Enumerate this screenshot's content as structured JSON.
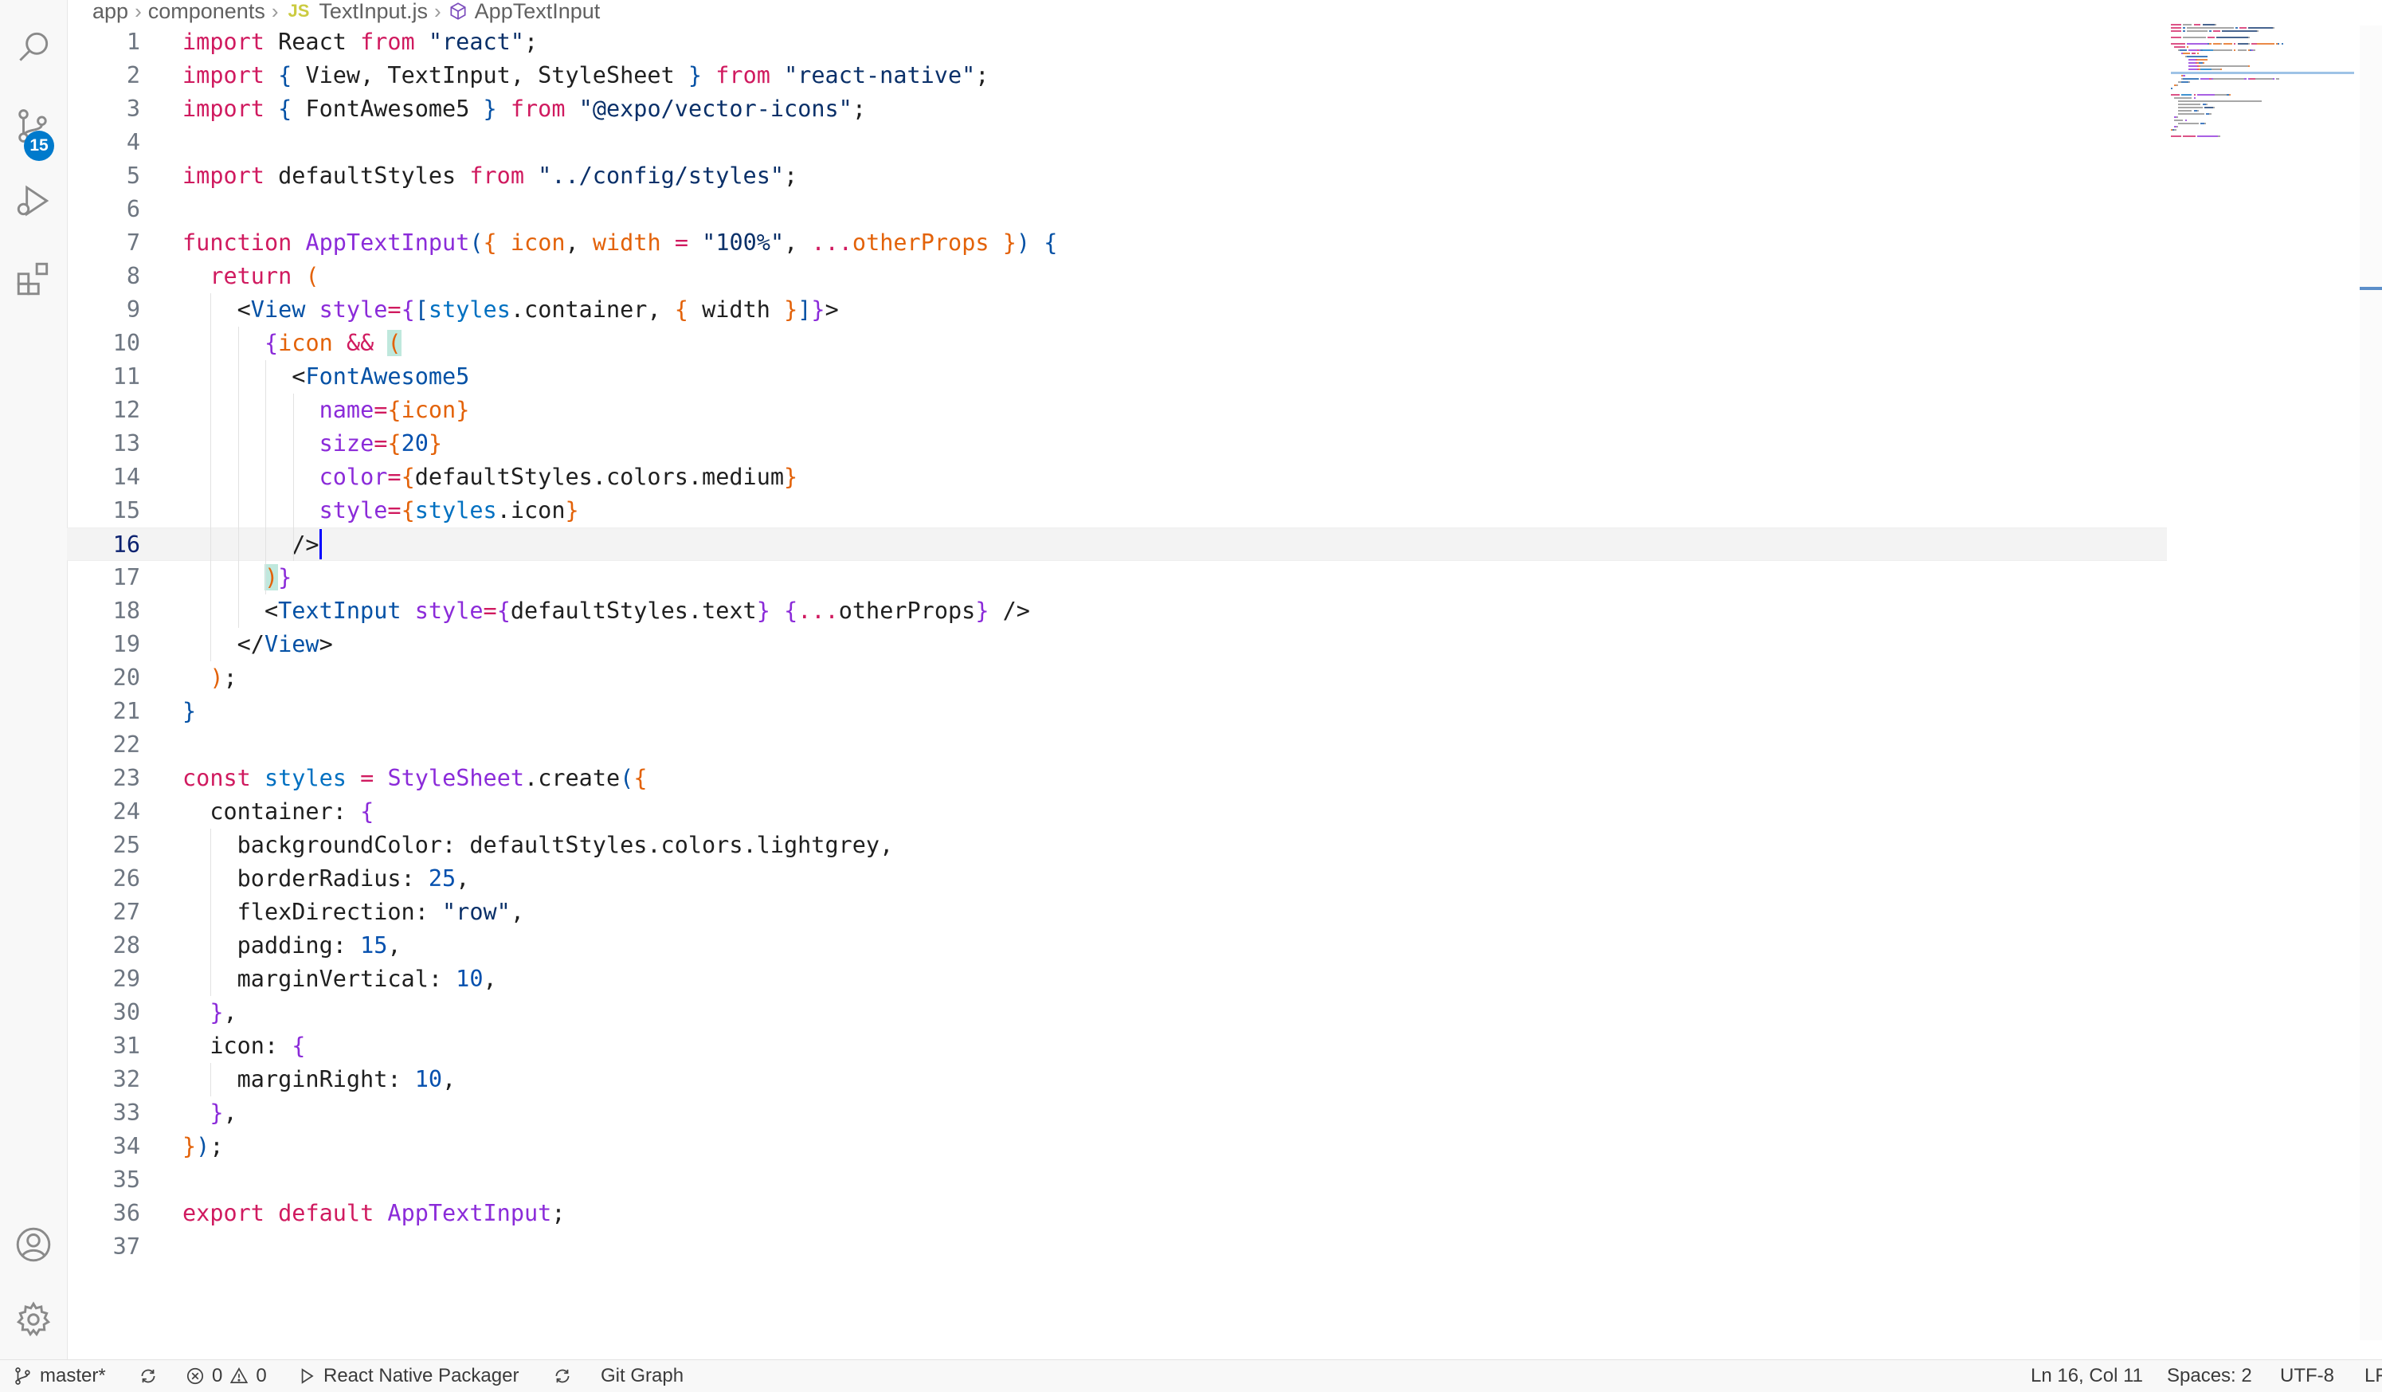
{
  "breadcrumb": {
    "items": [
      "app",
      "components",
      "TextInput.js",
      "AppTextInput"
    ],
    "file_badge": "JS"
  },
  "activity": {
    "scm_badge": "15"
  },
  "editor": {
    "active_line": 16,
    "lines": [
      {
        "n": "1",
        "t": [
          [
            "kw",
            "import"
          ],
          [
            "",
            " React "
          ],
          [
            "kw",
            "from"
          ],
          [
            "",
            ""
          ],
          [
            "str",
            " \"react\""
          ],
          [
            "",
            ";"
          ]
        ]
      },
      {
        "n": "2",
        "t": [
          [
            "kw",
            "import"
          ],
          [
            "",
            " "
          ],
          [
            "b1",
            "{"
          ],
          [
            "",
            " View, TextInput, StyleSheet "
          ],
          [
            "b1",
            "}"
          ],
          [
            "",
            " "
          ],
          [
            "kw",
            "from"
          ],
          [
            "",
            " "
          ],
          [
            "str",
            "\"react-native\""
          ],
          [
            "",
            ";"
          ]
        ]
      },
      {
        "n": "3",
        "t": [
          [
            "kw",
            "import"
          ],
          [
            "",
            " "
          ],
          [
            "b1",
            "{"
          ],
          [
            "",
            " FontAwesome5 "
          ],
          [
            "b1",
            "}"
          ],
          [
            "",
            " "
          ],
          [
            "kw",
            "from"
          ],
          [
            "",
            " "
          ],
          [
            "str",
            "\"@expo/vector-icons\""
          ],
          [
            "",
            ";"
          ]
        ]
      },
      {
        "n": "4",
        "t": []
      },
      {
        "n": "5",
        "t": [
          [
            "kw",
            "import"
          ],
          [
            "",
            " defaultStyles "
          ],
          [
            "kw",
            "from"
          ],
          [
            "",
            " "
          ],
          [
            "str",
            "\"../config/styles\""
          ],
          [
            "",
            ";"
          ]
        ]
      },
      {
        "n": "6",
        "t": []
      },
      {
        "n": "7",
        "t": [
          [
            "kw",
            "function"
          ],
          [
            "",
            " "
          ],
          [
            "fn",
            "AppTextInput"
          ],
          [
            "b1",
            "("
          ],
          [
            "b2",
            "{"
          ],
          [
            "",
            " "
          ],
          [
            "pm",
            "icon"
          ],
          [
            "",
            ", "
          ],
          [
            "pm",
            "width"
          ],
          [
            "",
            " "
          ],
          [
            "op",
            "="
          ],
          [
            "",
            " "
          ],
          [
            "str",
            "\"100%\""
          ],
          [
            "",
            ", "
          ],
          [
            "op",
            "..."
          ],
          [
            "pm",
            "otherProps"
          ],
          [
            "",
            " "
          ],
          [
            "b2",
            "}"
          ],
          [
            "b1",
            ")"
          ],
          [
            "",
            " "
          ],
          [
            "b1",
            "{"
          ]
        ]
      },
      {
        "n": "8",
        "t": [
          [
            "",
            "  "
          ],
          [
            "kw",
            "return"
          ],
          [
            "",
            " "
          ],
          [
            "b2",
            "("
          ]
        ]
      },
      {
        "n": "9",
        "t": [
          [
            "",
            "    <"
          ],
          [
            "tg",
            "View"
          ],
          [
            "",
            " "
          ],
          [
            "fn",
            "style"
          ],
          [
            "op",
            "="
          ],
          [
            "b3",
            "{"
          ],
          [
            "b1",
            "["
          ],
          [
            "vr",
            "styles"
          ],
          [
            "",
            ".container, "
          ],
          [
            "b2",
            "{"
          ],
          [
            "",
            " width "
          ],
          [
            "b2",
            "}"
          ],
          [
            "b1",
            "]"
          ],
          [
            "b3",
            "}"
          ],
          [
            "",
            ">"
          ]
        ]
      },
      {
        "n": "10",
        "t": [
          [
            "",
            "      "
          ],
          [
            "b3",
            "{"
          ],
          [
            "pm",
            "icon"
          ],
          [
            "",
            " "
          ],
          [
            "op",
            "&&"
          ],
          [
            "",
            " "
          ],
          [
            "hlb2",
            "("
          ]
        ]
      },
      {
        "n": "11",
        "t": [
          [
            "",
            "        <"
          ],
          [
            "tg",
            "FontAwesome5"
          ]
        ]
      },
      {
        "n": "12",
        "t": [
          [
            "",
            "          "
          ],
          [
            "fn",
            "name"
          ],
          [
            "op",
            "="
          ],
          [
            "b2",
            "{"
          ],
          [
            "pm",
            "icon"
          ],
          [
            "b2",
            "}"
          ]
        ]
      },
      {
        "n": "13",
        "t": [
          [
            "",
            "          "
          ],
          [
            "fn",
            "size"
          ],
          [
            "op",
            "="
          ],
          [
            "b2",
            "{"
          ],
          [
            "nm",
            "20"
          ],
          [
            "b2",
            "}"
          ]
        ]
      },
      {
        "n": "14",
        "t": [
          [
            "",
            "          "
          ],
          [
            "fn",
            "color"
          ],
          [
            "op",
            "="
          ],
          [
            "b2",
            "{"
          ],
          [
            "",
            "defaultStyles.colors.medium"
          ],
          [
            "b2",
            "}"
          ]
        ]
      },
      {
        "n": "15",
        "t": [
          [
            "",
            "          "
          ],
          [
            "fn",
            "style"
          ],
          [
            "op",
            "="
          ],
          [
            "b2",
            "{"
          ],
          [
            "vr",
            "styles"
          ],
          [
            "",
            ".icon"
          ],
          [
            "b2",
            "}"
          ]
        ]
      },
      {
        "n": "16",
        "t": [
          [
            "",
            "        />"
          ]
        ]
      },
      {
        "n": "17",
        "t": [
          [
            "",
            "      "
          ],
          [
            "hlb2",
            ")"
          ],
          [
            "b3",
            "}"
          ]
        ]
      },
      {
        "n": "18",
        "t": [
          [
            "",
            "      <"
          ],
          [
            "tg",
            "TextInput"
          ],
          [
            "",
            " "
          ],
          [
            "fn",
            "style"
          ],
          [
            "op",
            "="
          ],
          [
            "b3",
            "{"
          ],
          [
            "",
            "defaultStyles.text"
          ],
          [
            "b3",
            "}"
          ],
          [
            "",
            " "
          ],
          [
            "b3",
            "{"
          ],
          [
            "op",
            "..."
          ],
          [
            "",
            "otherProps"
          ],
          [
            "b3",
            "}"
          ],
          [
            "",
            " />"
          ]
        ]
      },
      {
        "n": "19",
        "t": [
          [
            "",
            "    </"
          ],
          [
            "tg",
            "View"
          ],
          [
            "",
            ">"
          ]
        ]
      },
      {
        "n": "20",
        "t": [
          [
            "",
            "  "
          ],
          [
            "b2",
            ")"
          ],
          [
            "",
            ";"
          ]
        ]
      },
      {
        "n": "21",
        "t": [
          [
            "b1",
            "}"
          ]
        ]
      },
      {
        "n": "22",
        "t": []
      },
      {
        "n": "23",
        "t": [
          [
            "kw",
            "const"
          ],
          [
            "",
            " "
          ],
          [
            "vr",
            "styles"
          ],
          [
            "",
            " "
          ],
          [
            "op",
            "="
          ],
          [
            "",
            " "
          ],
          [
            "fn",
            "StyleSheet"
          ],
          [
            "",
            ".create"
          ],
          [
            "b1",
            "("
          ],
          [
            "b2",
            "{"
          ]
        ]
      },
      {
        "n": "24",
        "t": [
          [
            "",
            "  container: "
          ],
          [
            "b3",
            "{"
          ]
        ]
      },
      {
        "n": "25",
        "t": [
          [
            "",
            "    backgroundColor: defaultStyles.colors.lightgrey,"
          ]
        ]
      },
      {
        "n": "26",
        "t": [
          [
            "",
            "    borderRadius: "
          ],
          [
            "nm",
            "25"
          ],
          [
            "",
            ","
          ]
        ]
      },
      {
        "n": "27",
        "t": [
          [
            "",
            "    flexDirection: "
          ],
          [
            "str",
            "\"row\""
          ],
          [
            "",
            ","
          ]
        ]
      },
      {
        "n": "28",
        "t": [
          [
            "",
            "    padding: "
          ],
          [
            "nm",
            "15"
          ],
          [
            "",
            ","
          ]
        ]
      },
      {
        "n": "29",
        "t": [
          [
            "",
            "    marginVertical: "
          ],
          [
            "nm",
            "10"
          ],
          [
            "",
            ","
          ]
        ]
      },
      {
        "n": "30",
        "t": [
          [
            "",
            "  "
          ],
          [
            "b3",
            "}"
          ],
          [
            "",
            ","
          ]
        ]
      },
      {
        "n": "31",
        "t": [
          [
            "",
            "  icon: "
          ],
          [
            "b3",
            "{"
          ]
        ]
      },
      {
        "n": "32",
        "t": [
          [
            "",
            "    marginRight: "
          ],
          [
            "nm",
            "10"
          ],
          [
            "",
            ","
          ]
        ]
      },
      {
        "n": "33",
        "t": [
          [
            "",
            "  "
          ],
          [
            "b3",
            "}"
          ],
          [
            "",
            ","
          ]
        ]
      },
      {
        "n": "34",
        "t": [
          [
            "b2",
            "}"
          ],
          [
            "b1",
            ")"
          ],
          [
            "",
            ";"
          ]
        ]
      },
      {
        "n": "35",
        "t": []
      },
      {
        "n": "36",
        "t": [
          [
            "kw",
            "export"
          ],
          [
            "",
            " "
          ],
          [
            "kw",
            "default"
          ],
          [
            "",
            " "
          ],
          [
            "fn",
            "AppTextInput"
          ],
          [
            "",
            ";"
          ]
        ]
      },
      {
        "n": "37",
        "t": []
      }
    ]
  },
  "status": {
    "branch": "master*",
    "errors": "0",
    "warnings": "0",
    "packager": "React Native Packager",
    "git_graph": "Git Graph",
    "position": "Ln 16, Col 11",
    "spaces": "Spaces: 2",
    "encoding": "UTF-8",
    "eol": "LF"
  }
}
